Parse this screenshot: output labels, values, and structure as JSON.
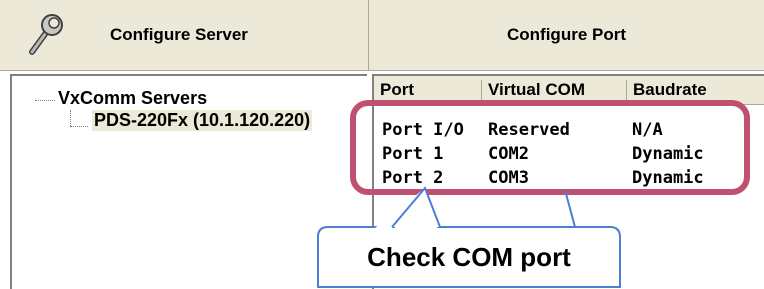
{
  "toolbar": {
    "configure_server_label": "Configure Server",
    "configure_port_label": "Configure Port"
  },
  "tree": {
    "root_label": "VxComm Servers",
    "child_label": "PDS-220Fx (10.1.120.220)"
  },
  "port_table": {
    "columns": [
      "Port",
      "Virtual COM",
      "Baudrate"
    ],
    "rows": [
      {
        "port": "Port I/O",
        "virtual_com": "Reserved",
        "baudrate": "N/A"
      },
      {
        "port": "Port 1",
        "virtual_com": "COM2",
        "baudrate": "Dynamic"
      },
      {
        "port": "Port 2",
        "virtual_com": "COM3",
        "baudrate": "Dynamic"
      }
    ]
  },
  "annotation": {
    "callout_text": "Check COM port",
    "highlight_color": "#c0506f",
    "callout_border_color": "#4a7fd4"
  },
  "icons": {
    "configure_server_icon": "wrench-icon"
  }
}
